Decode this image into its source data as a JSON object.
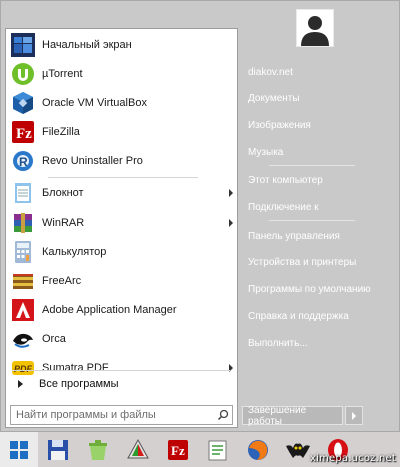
{
  "pinned": [
    {
      "label": "Начальный экран",
      "icon": "start-screen-icon"
    },
    {
      "label": "µTorrent",
      "icon": "utorrent-icon"
    },
    {
      "label": "Oracle VM VirtualBox",
      "icon": "virtualbox-icon"
    },
    {
      "label": "FileZilla",
      "icon": "filezilla-icon"
    },
    {
      "label": "Revo Uninstaller Pro",
      "icon": "revo-uninstaller-icon"
    }
  ],
  "recent": [
    {
      "label": "Блокнот",
      "icon": "notepad-icon",
      "submenu": true
    },
    {
      "label": "WinRAR",
      "icon": "winrar-icon",
      "submenu": true
    },
    {
      "label": "Калькулятор",
      "icon": "calculator-icon",
      "submenu": false
    },
    {
      "label": "FreeArc",
      "icon": "freearc-icon",
      "submenu": false
    },
    {
      "label": "Adobe Application Manager",
      "icon": "adobe-icon",
      "submenu": false
    },
    {
      "label": "Orca",
      "icon": "orca-icon",
      "submenu": false
    },
    {
      "label": "Sumatra PDF",
      "icon": "sumatra-icon",
      "submenu": true
    }
  ],
  "all_programs": "Все программы",
  "search": {
    "placeholder": "Найти программы и файлы"
  },
  "right": {
    "group1": [
      "diakov.net",
      "Документы",
      "Изображения",
      "Музыка"
    ],
    "group2": [
      "Этот компьютер",
      "Подключение к"
    ],
    "group3": [
      "Панель управления",
      "Устройства и принтеры",
      "Программы по умолчанию",
      "Справка и поддержка",
      "Выполнить..."
    ]
  },
  "shutdown_label": "Завершение работы",
  "taskbar": [
    "floppy-icon",
    "recycle-bin-icon",
    "clipart-icon",
    "filezilla-taskbar-icon",
    "notepad-taskbar-icon",
    "firefox-icon",
    "bat-icon",
    "opera-icon"
  ],
  "watermark": "ximepa.ucoz.net",
  "colors": {
    "menu_bg": "#c9c9c9",
    "list_bg": "#ffffff",
    "taskbar_bg": "#d4d0d0",
    "accent_blue": "#1e6fc4"
  }
}
